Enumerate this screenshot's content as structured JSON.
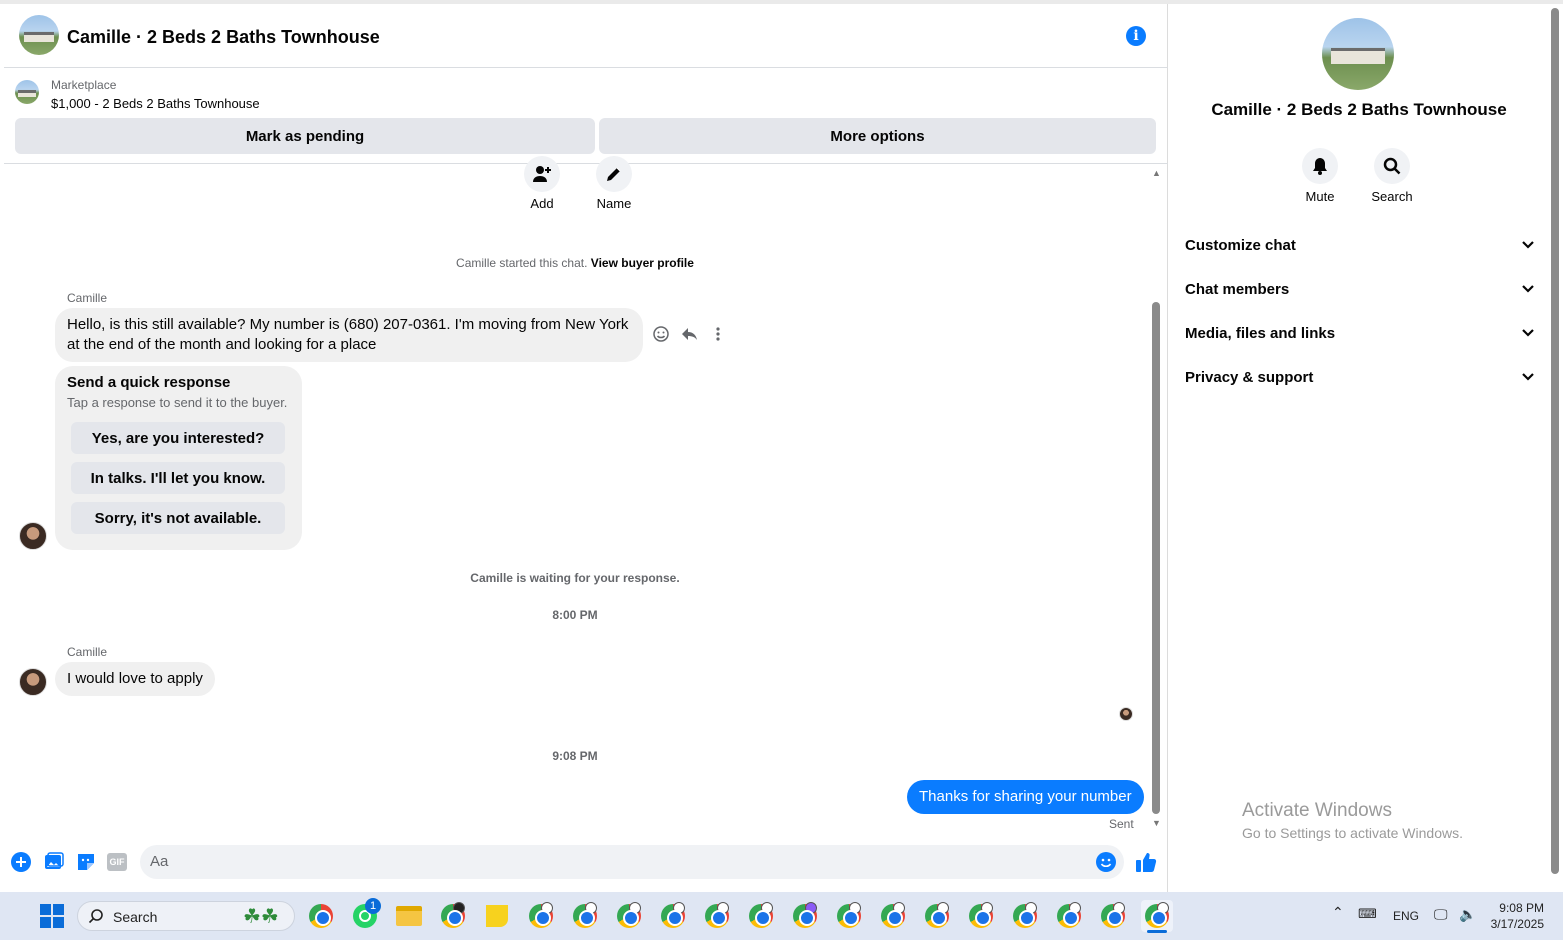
{
  "header": {
    "title": "Camille · 2 Beds 2 Baths Townhouse"
  },
  "listing": {
    "source": "Marketplace",
    "price_title": "$1,000 - 2 Beds 2 Baths Townhouse",
    "mark_pending": "Mark as pending",
    "more_options": "More options"
  },
  "top_actions": {
    "add": "Add",
    "name": "Name"
  },
  "thread": {
    "started_prefix": "Camille started this chat.",
    "view_profile": "View buyer profile",
    "sender1": "Camille",
    "message1": "Hello, is this still available? My number is (680) 207-0361. I'm moving from New York at the end of the month and looking for a place",
    "quick_title": "Send a quick response",
    "quick_subtitle": "Tap a response to send it to the buyer.",
    "quick_responses": [
      "Yes, are you interested?",
      "In talks. I'll let you know.",
      "Sorry, it's not available."
    ],
    "waiting": "Camille is waiting for your response.",
    "time1": "8:00 PM",
    "sender2": "Camille",
    "message2": "I would love to apply",
    "time2": "9:08 PM",
    "my_message": "Thanks for sharing your number",
    "status": "Sent"
  },
  "composer": {
    "placeholder": "Aa"
  },
  "right_panel": {
    "title": "Camille · 2 Beds 2 Baths Townhouse",
    "mute": "Mute",
    "search": "Search",
    "sections": [
      "Customize chat",
      "Chat members",
      "Media, files and links",
      "Privacy & support"
    ]
  },
  "watermark": {
    "title": "Activate Windows",
    "subtitle": "Go to Settings to activate Windows."
  },
  "taskbar": {
    "search": "Search",
    "whatsapp_badge": "1",
    "lang": "ENG",
    "time": "9:08 PM",
    "date": "3/17/2025"
  },
  "colors": {
    "accent": "#0a7cff",
    "bubble_gray": "#f0f0f0",
    "button_gray": "#e4e6eb"
  }
}
